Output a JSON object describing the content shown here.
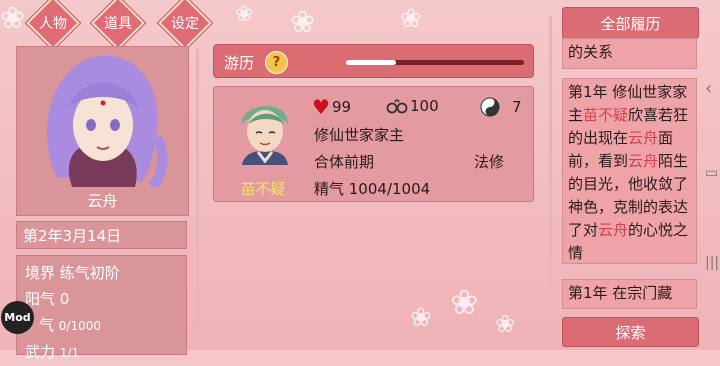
{
  "tabs": [
    "人物",
    "道具",
    "设定"
  ],
  "player": {
    "name": "云舟",
    "date": "第2年3月14日",
    "realm": "境界 练气初阶",
    "yang": "阳气 0",
    "qi_label": "气",
    "qi_value": "0/1000",
    "wuli_label": "武力",
    "wuli_value": "1/1"
  },
  "mod_badge": "Mod",
  "travel": {
    "label": "游历",
    "help": "?",
    "progress": 0.28
  },
  "character": {
    "name": "苗不疑",
    "hearts": "99",
    "bonds": "100",
    "karma": "7",
    "identity": "修仙世家家主",
    "stage": "合体前期",
    "path": "法修",
    "essence": "精气 1004/1004"
  },
  "history": {
    "button": "全部履历",
    "entry_prev": "的关系",
    "entry_main_parts": [
      "第1年 修仙世家家主",
      "苗不疑",
      "欣喜若狂的出现在",
      "云舟",
      "面前，看到",
      "云舟",
      "陌生的目光，他收敛了神色，克制的表达了对",
      "云舟",
      "的心悦之情"
    ],
    "entry_next": "第1年 在宗门藏",
    "explore_button": "探索"
  },
  "icons": {
    "heart": "heart-icon",
    "bond": "handcuff-icon",
    "karma": "yinyang-icon",
    "help": "question-icon"
  },
  "colors": {
    "accent": "#dc6c74",
    "highlight_name": "#d4414f",
    "char_name": "#f3e06a"
  }
}
